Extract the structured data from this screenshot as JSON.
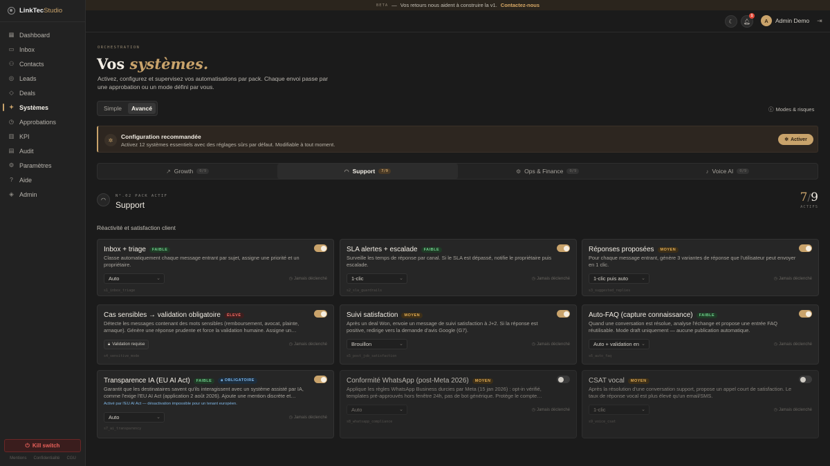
{
  "brand": {
    "name": "LinkTec",
    "suffix": "Studio"
  },
  "nav": [
    {
      "label": "Dashboard",
      "icon": "dashboard-icon",
      "glyph": "▦"
    },
    {
      "label": "Inbox",
      "icon": "inbox-icon",
      "glyph": "▭"
    },
    {
      "label": "Contacts",
      "icon": "contacts-icon",
      "glyph": "⚇"
    },
    {
      "label": "Leads",
      "icon": "leads-icon",
      "glyph": "◎"
    },
    {
      "label": "Deals",
      "icon": "deals-icon",
      "glyph": "◇"
    },
    {
      "label": "Systèmes",
      "icon": "systems-icon",
      "glyph": "✦",
      "active": true
    },
    {
      "label": "Approbations",
      "icon": "approvals-icon",
      "glyph": "◷"
    },
    {
      "label": "KPI",
      "icon": "kpi-icon",
      "glyph": "▥"
    },
    {
      "label": "Audit",
      "icon": "audit-icon",
      "glyph": "▤"
    },
    {
      "label": "Paramètres",
      "icon": "settings-icon",
      "glyph": "⚙"
    },
    {
      "label": "Aide",
      "icon": "help-icon",
      "glyph": "?"
    },
    {
      "label": "Admin",
      "icon": "admin-icon",
      "glyph": "◈"
    }
  ],
  "kill_switch": "Kill switch",
  "footer_links": [
    "Mentions",
    "Confidentialité",
    "CGU"
  ],
  "beta": {
    "tag": "BETA",
    "dash": "—",
    "text": "Vos retours nous aident à construire la v1.",
    "link": "Contactez-nous"
  },
  "topbar": {
    "notifications": "1",
    "avatar_initial": "A",
    "user_name": "Admin Demo"
  },
  "page": {
    "eyebrow": "ORCHESTRATION",
    "title_plain": "Vos",
    "title_accent": "systèmes.",
    "description": "Activez, configurez et supervisez vos automatisations par pack. Chaque envoi passe par une approbation ou un mode défini par vous.",
    "mode_simple": "Simple",
    "mode_advanced": "Avancé",
    "risks_link": "Modes & risques"
  },
  "recommended": {
    "title": "Configuration recommandée",
    "text": "Activez 12 systèmes essentiels avec des réglages sûrs par défaut. Modifiable à tout moment.",
    "button": "Activer"
  },
  "packs": [
    {
      "label": "Growth",
      "count": "0/9",
      "icon": "growth-icon",
      "glyph": "↗"
    },
    {
      "label": "Support",
      "count": "7/9",
      "icon": "headset-icon",
      "glyph": "◠",
      "selected": true
    },
    {
      "label": "Ops & Finance",
      "count": "0/9",
      "icon": "gear-icon",
      "glyph": "⚙"
    },
    {
      "label": "Voice AI",
      "count": "0/9",
      "icon": "mic-icon",
      "glyph": "♪"
    }
  ],
  "active_pack": {
    "eyebrow": "N°.02 PACK ACTIF",
    "name": "Support",
    "active": "7",
    "separator": "/",
    "total": "9",
    "count_label": "ACTIFS",
    "subtitle": "Réactivité et satisfaction client"
  },
  "cards": [
    {
      "name": "Inbox + triage",
      "risk": "FAIBLE",
      "risk_class": "faible",
      "enabled": true,
      "desc": "Classe automatiquement chaque message entrant par sujet, assigne une priorité et un propriétaire.",
      "select": "Auto",
      "status": "Jamais déclenché",
      "code": "s1_inbox_triage"
    },
    {
      "name": "SLA alertes + escalade",
      "risk": "FAIBLE",
      "risk_class": "faible",
      "enabled": true,
      "desc": "Surveille les temps de réponse par canal. Si le SLA est dépassé, notifie le propriétaire puis escalade.",
      "select": "1-clic",
      "status": "Jamais déclenché",
      "code": "s2_sla_guardrails"
    },
    {
      "name": "Réponses proposées",
      "risk": "MOYEN",
      "risk_class": "moyen",
      "enabled": true,
      "desc": "Pour chaque message entrant, génère 3 variantes de réponse que l'utilisateur peut envoyer en 1 clic.",
      "select": "1-clic puis auto",
      "status": "Jamais déclenché",
      "code": "s3_suggested_replies"
    },
    {
      "name": "Cas sensibles → validation obligatoire",
      "risk": "ÉLEVÉ",
      "risk_class": "eleve",
      "enabled": true,
      "desc": "Détecte les messages contenant des mots sensibles (remboursement, avocat, plainte, arnaque). Génère une réponse prudente et force la validation humaine. Assigne un…",
      "chip": "Validation requise",
      "status": "Jamais déclenché",
      "code": "s4_sensitive_mode"
    },
    {
      "name": "Suivi satisfaction",
      "risk": "MOYEN",
      "risk_class": "moyen",
      "enabled": true,
      "desc": "Après un deal Won, envoie un message de suivi satisfaction à J+2. Si la réponse est positive, redirige vers la demande d'avis Google (G7).",
      "select": "Brouillon",
      "status": "Jamais déclenché",
      "code": "s5_post_job_satisfaction"
    },
    {
      "name": "Auto-FAQ (capture connaissance)",
      "risk": "FAIBLE",
      "risk_class": "faible",
      "enabled": true,
      "desc": "Quand une conversation est résolue, analyse l'échange et propose une entrée FAQ réutilisable. Mode draft uniquement — aucune publication automatique.",
      "select": "Auto + validation en",
      "status": "Jamais déclenché",
      "code": "s6_auto_faq"
    },
    {
      "name": "Transparence IA (EU AI Act)",
      "risk": "FAIBLE",
      "risk_class": "faible",
      "extra_badge": "OBLIGATOIRE",
      "enabled": true,
      "desc": "Garantit que les destinataires savent qu'ils interagissent avec un système assisté par IA, comme l'exige l'EU AI Act (application 2 août 2026). Ajoute une mention discrète et…",
      "note": "Activé par l'EU AI Act — désactivation impossible pour un tenant européen.",
      "select": "Auto",
      "status": "Jamais déclenché",
      "code": "s7_ai_transparency"
    },
    {
      "name": "Conformité WhatsApp (post-Meta 2026)",
      "risk": "MOYEN",
      "risk_class": "moyen",
      "enabled": false,
      "desc": "Applique les règles WhatsApp Business durcies par Meta (15 jan 2026) : opt-in vérifié, templates pré-approuvés hors fenêtre 24h, pas de bot générique. Protège le compte…",
      "select": "Auto",
      "status": "Jamais déclenché",
      "code": "s8_whatsapp_compliance"
    },
    {
      "name": "CSAT vocal",
      "risk": "MOYEN",
      "risk_class": "moyen",
      "enabled": false,
      "desc": "Après la résolution d'une conversation support, propose un appel court de satisfaction. Le taux de réponse vocal est plus élevé qu'un email/SMS.",
      "select": "1-clic",
      "status": "Jamais déclenché",
      "code": "s9_voice_csat"
    }
  ]
}
